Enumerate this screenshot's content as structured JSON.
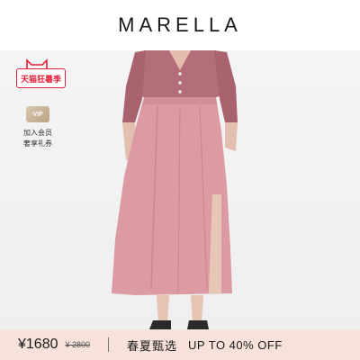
{
  "brand": {
    "name": "MARELLA"
  },
  "tmall": {
    "badge_text": "天猫狂暑季",
    "icon": "tmall-cat-icon",
    "color": "#e0223a"
  },
  "membership": {
    "card_text": "VIP",
    "line1": "加入会员",
    "line2": "奢享礼券",
    "icon": "vip-card-icon"
  },
  "product": {
    "image": "model-wearing-pink-knit-top-and-pink-midi-skirt",
    "top_color": "#b9707c",
    "skirt_color": "#dd9ea4"
  },
  "price_bar": {
    "price": "¥1680",
    "original_price": "¥ 2800",
    "promo_title": "春夏甄选",
    "promo_offer": "UP TO 40% OFF",
    "background": "#f7e1db"
  }
}
